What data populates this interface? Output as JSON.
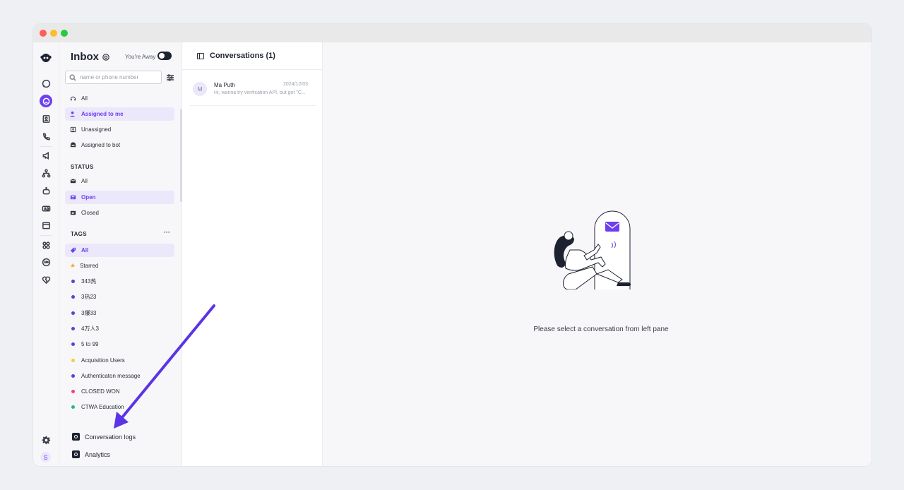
{
  "inbox": {
    "title": "Inbox",
    "away_label": "You're Away",
    "search_placeholder": "name or phone number"
  },
  "views": [
    {
      "label": "All",
      "icon": "headset-icon",
      "selected": false
    },
    {
      "label": "Assigned to me",
      "icon": "user-icon",
      "selected": true
    },
    {
      "label": "Unassigned",
      "icon": "user-square-icon",
      "selected": false
    },
    {
      "label": "Assigned to bot",
      "icon": "bot-icon",
      "selected": false
    }
  ],
  "status": {
    "heading": "STATUS",
    "items": [
      {
        "label": "All",
        "selected": false
      },
      {
        "label": "Open",
        "selected": true
      },
      {
        "label": "Closed",
        "selected": false
      }
    ]
  },
  "tags": {
    "heading": "TAGS",
    "more": "···",
    "items": [
      {
        "label": "All",
        "color": "#6d3ff0",
        "selected": true
      },
      {
        "label": "Starred",
        "color": "#f5a623",
        "selected": false
      },
      {
        "label": "343热",
        "color": "#5b3fd6",
        "selected": false
      },
      {
        "label": "3热23",
        "color": "#5b3fd6",
        "selected": false
      },
      {
        "label": "3爆33",
        "color": "#5b3fd6",
        "selected": false
      },
      {
        "label": "4万人3",
        "color": "#5b3fd6",
        "selected": false
      },
      {
        "label": "5 to 99",
        "color": "#5b3fd6",
        "selected": false
      },
      {
        "label": "Acquisition Users",
        "color": "#f7c948",
        "selected": false
      },
      {
        "label": "Authenticaton message",
        "color": "#5b3fd6",
        "selected": false
      },
      {
        "label": "CLOSED WON",
        "color": "#f0456a",
        "selected": false
      },
      {
        "label": "CTWA Education",
        "color": "#1fba7a",
        "selected": false
      }
    ]
  },
  "footer": {
    "conversation_logs": "Conversation logs",
    "analytics": "Analytics"
  },
  "conversations": {
    "title": "Conversations (1)",
    "items": [
      {
        "initial": "M",
        "name": "Ma Puth",
        "date": "2024/12/03",
        "snippet": "Hi, wanna try verification API, but got \"C..."
      }
    ]
  },
  "main": {
    "empty_message": "Please select a conversation from left pane"
  },
  "user": {
    "avatar_initial": "S"
  },
  "colors": {
    "accent": "#6d3ff0",
    "arrow": "#5b34e6"
  }
}
